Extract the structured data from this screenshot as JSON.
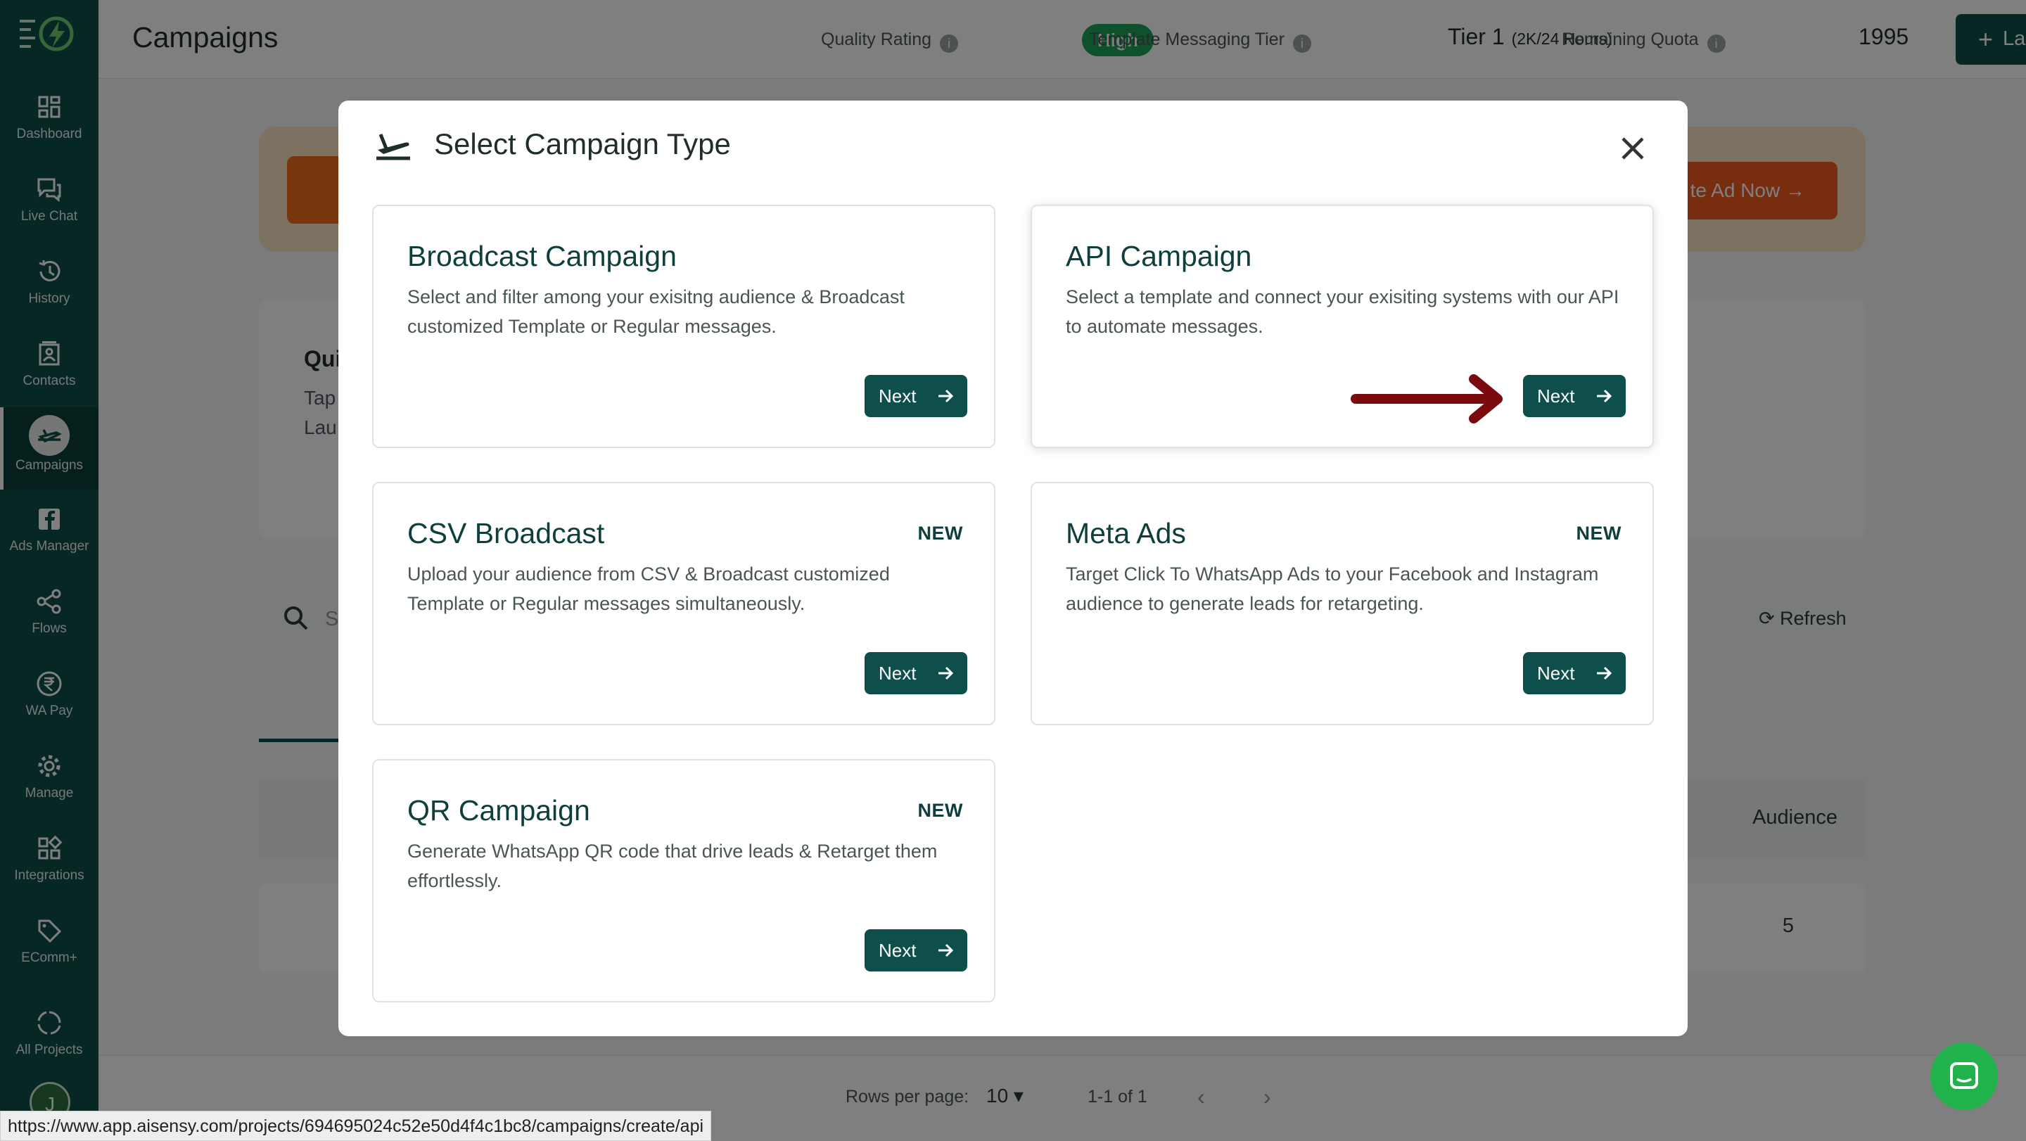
{
  "sidebar": {
    "items": [
      {
        "label": "Dashboard",
        "icon": "dashboard-icon"
      },
      {
        "label": "Live Chat",
        "icon": "chat-icon"
      },
      {
        "label": "History",
        "icon": "history-icon"
      },
      {
        "label": "Contacts",
        "icon": "contacts-icon"
      },
      {
        "label": "Campaigns",
        "icon": "campaigns-icon",
        "active": true
      },
      {
        "label": "Ads Manager",
        "icon": "facebook-icon"
      },
      {
        "label": "Flows",
        "icon": "flows-icon"
      },
      {
        "label": "WA Pay",
        "icon": "rupee-icon"
      },
      {
        "label": "Manage",
        "icon": "gear-icon"
      },
      {
        "label": "Integrations",
        "icon": "integrations-icon"
      },
      {
        "label": "EComm+",
        "icon": "tag-icon"
      },
      {
        "label": "All Projects",
        "icon": "projects-icon"
      }
    ],
    "avatar_initial": "J"
  },
  "topbar": {
    "title": "Campaigns",
    "quality_label": "Quality Rating",
    "quality_value": "High",
    "tier_label": "Template Messaging Tier",
    "tier_value": "Tier 1",
    "tier_limit": "(2K/24 Hours)",
    "quota_label": "Remaining Quota",
    "quota_value": "1995",
    "launch_label": "Launch"
  },
  "background": {
    "banner_button": "te Ad Now",
    "card_title": "Qui",
    "card_line1": "Tap",
    "card_line2": "Lau",
    "search_placeholder": "S",
    "refresh_label": "Refresh",
    "table_audience_header": "Audience",
    "row_audience_value": "5",
    "rows_per_page_label": "Rows per page:",
    "rows_per_page_value": "10",
    "range_label": "1-1 of 1"
  },
  "modal": {
    "title": "Select Campaign Type",
    "options": [
      {
        "title": "Broadcast Campaign",
        "desc": "Select and filter among your exisitng audience & Broadcast customized Template or Regular messages.",
        "badge": "",
        "next": "Next"
      },
      {
        "title": "API Campaign",
        "desc": "Select a template and connect your exisiting systems with our API to automate messages.",
        "badge": "",
        "next": "Next"
      },
      {
        "title": "CSV Broadcast",
        "desc": "Upload your audience from CSV & Broadcast customized Template or Regular messages simultaneously.",
        "badge": "NEW",
        "next": "Next"
      },
      {
        "title": "Meta Ads",
        "desc": "Target Click To WhatsApp Ads to your Facebook and Instagram audience to generate leads for retargeting.",
        "badge": "NEW",
        "next": "Next"
      },
      {
        "title": "QR Campaign",
        "desc": "Generate WhatsApp QR code that drive leads & Retarget them effortlessly.",
        "badge": "NEW",
        "next": "Next"
      }
    ]
  },
  "status_url": "https://www.app.aisensy.com/projects/694695024c52e50d4f4c1bc8/campaigns/create/api",
  "colors": {
    "brand": "#0f4f4b",
    "quality_high": "#1fa05a",
    "arrow_annotation": "#7a0a0e",
    "chat_fab": "#22b24c"
  }
}
